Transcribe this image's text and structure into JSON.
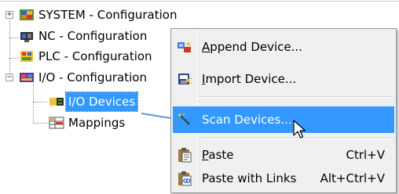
{
  "tree": {
    "items": [
      {
        "label": "SYSTEM - Configuration",
        "icon": "system-config-icon",
        "expander": "+"
      },
      {
        "label": "NC - Configuration",
        "icon": "nc-config-icon"
      },
      {
        "label": "PLC - Configuration",
        "icon": "plc-config-icon"
      },
      {
        "label": "I/O - Configuration",
        "icon": "io-config-icon",
        "expander": "−"
      },
      {
        "label": "I/O Devices",
        "icon": "io-devices-icon",
        "selected": true
      },
      {
        "label": "Mappings",
        "icon": "mappings-icon"
      }
    ]
  },
  "context_menu": {
    "items": [
      {
        "label": "Append Device...",
        "underline": "A",
        "rest": "ppend Device...",
        "icon": "append-device-icon"
      },
      {
        "label": "Import Device...",
        "underline": "I",
        "rest": "mport Device...",
        "icon": "import-device-icon"
      },
      {
        "label": "Scan Devices...",
        "icon": "scan-devices-icon",
        "highlighted": true
      },
      {
        "label": "Paste",
        "underline": "P",
        "rest": "aste",
        "shortcut": "Ctrl+V",
        "icon": "paste-icon"
      },
      {
        "label": "Paste with Links",
        "shortcut": "Alt+Ctrl+V",
        "icon": "paste-with-links-icon"
      }
    ]
  },
  "colors": {
    "selection": "#3399ff",
    "menu_background": "#f0f0f0",
    "arrow": "#5b9bd5"
  }
}
